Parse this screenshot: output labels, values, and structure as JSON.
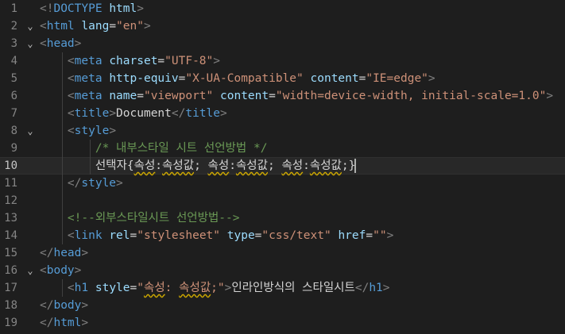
{
  "editor": {
    "active_line": 10,
    "lines": [
      {
        "num": "1",
        "fold": "",
        "tokens": [
          {
            "text": "<!",
            "cls": "c-br"
          },
          {
            "text": "DOCTYPE",
            "cls": "c-tag"
          },
          {
            "text": " ",
            "cls": "c-txt"
          },
          {
            "text": "html",
            "cls": "c-attr"
          },
          {
            "text": ">",
            "cls": "c-br"
          }
        ]
      },
      {
        "num": "2",
        "fold": "⌄",
        "tokens": [
          {
            "text": "<",
            "cls": "c-br"
          },
          {
            "text": "html",
            "cls": "c-tag"
          },
          {
            "text": " ",
            "cls": "c-txt"
          },
          {
            "text": "lang",
            "cls": "c-attr"
          },
          {
            "text": "=",
            "cls": "c-txt"
          },
          {
            "text": "\"en\"",
            "cls": "c-str"
          },
          {
            "text": ">",
            "cls": "c-br"
          }
        ]
      },
      {
        "num": "3",
        "fold": "⌄",
        "tokens": [
          {
            "text": "<",
            "cls": "c-br"
          },
          {
            "text": "head",
            "cls": "c-tag"
          },
          {
            "text": ">",
            "cls": "c-br"
          }
        ]
      },
      {
        "num": "4",
        "fold": "",
        "tokens": [
          {
            "text": "    ",
            "cls": "c-txt"
          },
          {
            "text": "<",
            "cls": "c-br"
          },
          {
            "text": "meta",
            "cls": "c-tag"
          },
          {
            "text": " ",
            "cls": "c-txt"
          },
          {
            "text": "charset",
            "cls": "c-attr"
          },
          {
            "text": "=",
            "cls": "c-txt"
          },
          {
            "text": "\"UTF-8\"",
            "cls": "c-str"
          },
          {
            "text": ">",
            "cls": "c-br"
          }
        ]
      },
      {
        "num": "5",
        "fold": "",
        "tokens": [
          {
            "text": "    ",
            "cls": "c-txt"
          },
          {
            "text": "<",
            "cls": "c-br"
          },
          {
            "text": "meta",
            "cls": "c-tag"
          },
          {
            "text": " ",
            "cls": "c-txt"
          },
          {
            "text": "http-equiv",
            "cls": "c-attr"
          },
          {
            "text": "=",
            "cls": "c-txt"
          },
          {
            "text": "\"X-UA-Compatible\"",
            "cls": "c-str"
          },
          {
            "text": " ",
            "cls": "c-txt"
          },
          {
            "text": "content",
            "cls": "c-attr"
          },
          {
            "text": "=",
            "cls": "c-txt"
          },
          {
            "text": "\"IE=edge\"",
            "cls": "c-str"
          },
          {
            "text": ">",
            "cls": "c-br"
          }
        ]
      },
      {
        "num": "6",
        "fold": "",
        "tokens": [
          {
            "text": "    ",
            "cls": "c-txt"
          },
          {
            "text": "<",
            "cls": "c-br"
          },
          {
            "text": "meta",
            "cls": "c-tag"
          },
          {
            "text": " ",
            "cls": "c-txt"
          },
          {
            "text": "name",
            "cls": "c-attr"
          },
          {
            "text": "=",
            "cls": "c-txt"
          },
          {
            "text": "\"viewport\"",
            "cls": "c-str"
          },
          {
            "text": " ",
            "cls": "c-txt"
          },
          {
            "text": "content",
            "cls": "c-attr"
          },
          {
            "text": "=",
            "cls": "c-txt"
          },
          {
            "text": "\"width=device-width, initial-scale=1.0\"",
            "cls": "c-str"
          },
          {
            "text": ">",
            "cls": "c-br"
          }
        ]
      },
      {
        "num": "7",
        "fold": "",
        "tokens": [
          {
            "text": "    ",
            "cls": "c-txt"
          },
          {
            "text": "<",
            "cls": "c-br"
          },
          {
            "text": "title",
            "cls": "c-tag"
          },
          {
            "text": ">",
            "cls": "c-br"
          },
          {
            "text": "Document",
            "cls": "c-txt"
          },
          {
            "text": "</",
            "cls": "c-br"
          },
          {
            "text": "title",
            "cls": "c-tag"
          },
          {
            "text": ">",
            "cls": "c-br"
          }
        ]
      },
      {
        "num": "8",
        "fold": "⌄",
        "tokens": [
          {
            "text": "    ",
            "cls": "c-txt"
          },
          {
            "text": "<",
            "cls": "c-br"
          },
          {
            "text": "style",
            "cls": "c-tag"
          },
          {
            "text": ">",
            "cls": "c-br"
          }
        ]
      },
      {
        "num": "9",
        "fold": "",
        "tokens": [
          {
            "text": "        ",
            "cls": "c-txt"
          },
          {
            "text": "/* 내부스타일 시트 선언방법 */",
            "cls": "c-cmt"
          }
        ]
      },
      {
        "num": "10",
        "fold": "",
        "tokens": [
          {
            "text": "        ",
            "cls": "c-txt"
          },
          {
            "text": "선택자",
            "cls": "c-txt"
          },
          {
            "text": "{",
            "cls": "c-txt"
          },
          {
            "text": "속성",
            "cls": "c-txt warn"
          },
          {
            "text": ":",
            "cls": "c-txt"
          },
          {
            "text": "속성값",
            "cls": "c-txt warn"
          },
          {
            "text": "; ",
            "cls": "c-txt"
          },
          {
            "text": "속성",
            "cls": "c-txt warn"
          },
          {
            "text": ":",
            "cls": "c-txt"
          },
          {
            "text": "속성값",
            "cls": "c-txt warn"
          },
          {
            "text": "; ",
            "cls": "c-txt"
          },
          {
            "text": "속성",
            "cls": "c-txt warn"
          },
          {
            "text": ":",
            "cls": "c-txt"
          },
          {
            "text": "속성값",
            "cls": "c-txt warn"
          },
          {
            "text": ";",
            "cls": "c-txt"
          },
          {
            "text": "}",
            "cls": "c-txt"
          }
        ]
      },
      {
        "num": "11",
        "fold": "",
        "tokens": [
          {
            "text": "    ",
            "cls": "c-txt"
          },
          {
            "text": "</",
            "cls": "c-br"
          },
          {
            "text": "style",
            "cls": "c-tag"
          },
          {
            "text": ">",
            "cls": "c-br"
          }
        ]
      },
      {
        "num": "12",
        "fold": "",
        "tokens": []
      },
      {
        "num": "13",
        "fold": "",
        "tokens": [
          {
            "text": "    ",
            "cls": "c-txt"
          },
          {
            "text": "<!--외부스타일시트 선언방법-->",
            "cls": "c-cmt"
          }
        ]
      },
      {
        "num": "14",
        "fold": "",
        "tokens": [
          {
            "text": "    ",
            "cls": "c-txt"
          },
          {
            "text": "<",
            "cls": "c-br"
          },
          {
            "text": "link",
            "cls": "c-tag"
          },
          {
            "text": " ",
            "cls": "c-txt"
          },
          {
            "text": "rel",
            "cls": "c-attr"
          },
          {
            "text": "=",
            "cls": "c-txt"
          },
          {
            "text": "\"stylesheet\"",
            "cls": "c-str"
          },
          {
            "text": " ",
            "cls": "c-txt"
          },
          {
            "text": "type",
            "cls": "c-attr"
          },
          {
            "text": "=",
            "cls": "c-txt"
          },
          {
            "text": "\"css/text\"",
            "cls": "c-str"
          },
          {
            "text": " ",
            "cls": "c-txt"
          },
          {
            "text": "href",
            "cls": "c-attr"
          },
          {
            "text": "=",
            "cls": "c-txt"
          },
          {
            "text": "\"\"",
            "cls": "c-str"
          },
          {
            "text": ">",
            "cls": "c-br"
          }
        ]
      },
      {
        "num": "15",
        "fold": "",
        "tokens": [
          {
            "text": "</",
            "cls": "c-br"
          },
          {
            "text": "head",
            "cls": "c-tag"
          },
          {
            "text": ">",
            "cls": "c-br"
          }
        ]
      },
      {
        "num": "16",
        "fold": "⌄",
        "tokens": [
          {
            "text": "<",
            "cls": "c-br"
          },
          {
            "text": "body",
            "cls": "c-tag"
          },
          {
            "text": ">",
            "cls": "c-br"
          }
        ]
      },
      {
        "num": "17",
        "fold": "",
        "tokens": [
          {
            "text": "    ",
            "cls": "c-txt"
          },
          {
            "text": "<",
            "cls": "c-br"
          },
          {
            "text": "h1",
            "cls": "c-tag"
          },
          {
            "text": " ",
            "cls": "c-txt"
          },
          {
            "text": "style",
            "cls": "c-attr"
          },
          {
            "text": "=",
            "cls": "c-txt"
          },
          {
            "text": "\"",
            "cls": "c-str"
          },
          {
            "text": "속성",
            "cls": "c-str warn"
          },
          {
            "text": ": ",
            "cls": "c-str"
          },
          {
            "text": "속성값",
            "cls": "c-str warn"
          },
          {
            "text": ";\"",
            "cls": "c-str"
          },
          {
            "text": ">",
            "cls": "c-br"
          },
          {
            "text": "인라인방식의 스타일시트",
            "cls": "c-txt"
          },
          {
            "text": "</",
            "cls": "c-br"
          },
          {
            "text": "h1",
            "cls": "c-tag"
          },
          {
            "text": ">",
            "cls": "c-br"
          }
        ]
      },
      {
        "num": "18",
        "fold": "",
        "tokens": [
          {
            "text": "</",
            "cls": "c-br"
          },
          {
            "text": "body",
            "cls": "c-tag"
          },
          {
            "text": ">",
            "cls": "c-br"
          }
        ]
      },
      {
        "num": "19",
        "fold": "",
        "tokens": [
          {
            "text": "</",
            "cls": "c-br"
          },
          {
            "text": "html",
            "cls": "c-tag"
          },
          {
            "text": ">",
            "cls": "c-br"
          }
        ]
      }
    ]
  },
  "colors": {
    "background": "#1e1e1e",
    "tag": "#569cd6",
    "attribute": "#9cdcfe",
    "string": "#ce9178",
    "comment": "#6a9955",
    "text": "#d4d4d4",
    "line_number": "#858585",
    "warning_squiggle": "#cca700"
  }
}
